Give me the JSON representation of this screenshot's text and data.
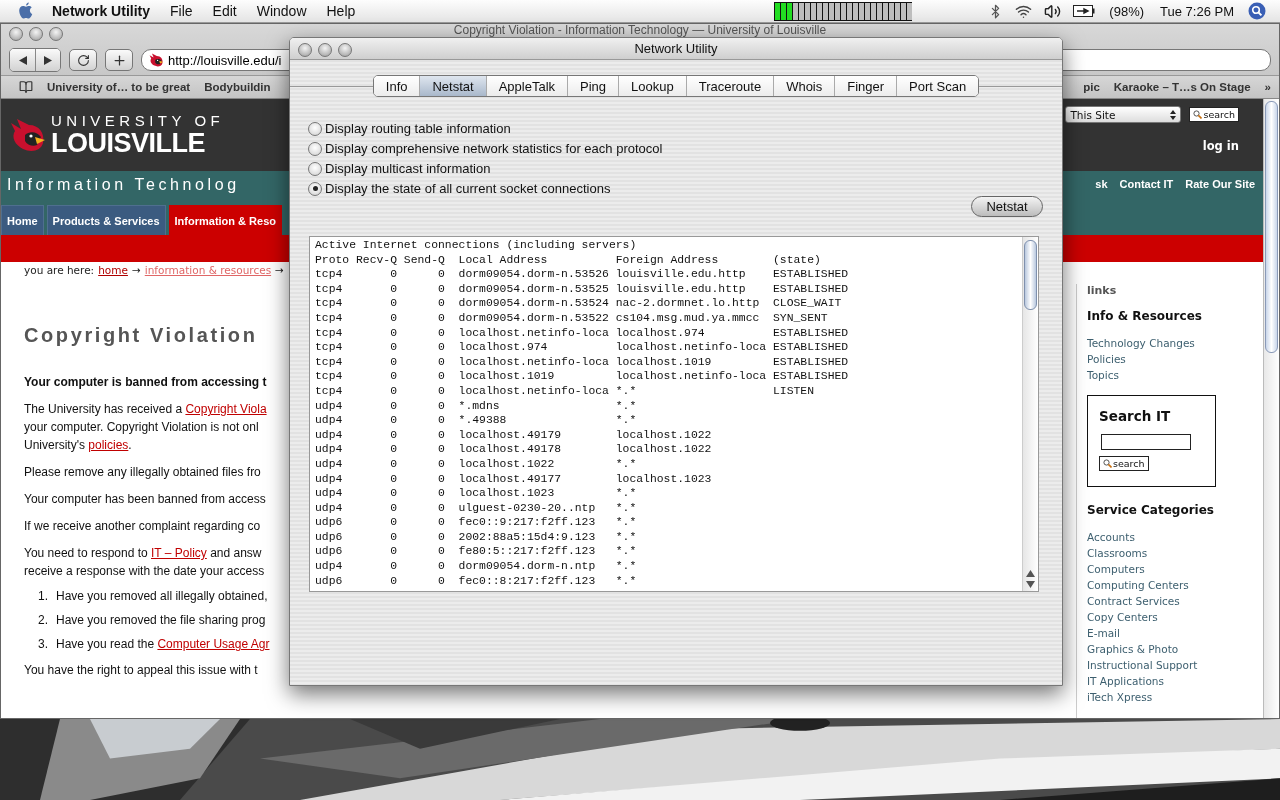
{
  "menu_bar": {
    "app_name": "Network Utility",
    "menus": [
      "File",
      "Edit",
      "Window",
      "Help"
    ],
    "battery": "(98%)",
    "clock": "Tue 7:26 PM"
  },
  "browser": {
    "title": "Copyright Violation - Information Technology — University of Louisville",
    "url": "http://louisville.edu/i",
    "bookmarks_left": [
      "University of… to be great",
      "Bodybuildin"
    ],
    "bookmarks_right": [
      "pic",
      "Karaoke – T…s On Stage"
    ],
    "bookmarks_more": "»"
  },
  "page": {
    "logo": {
      "line_1": "UNIVERSITY OF",
      "line_2": "LOUISVILLE"
    },
    "site_search": {
      "scope": "This Site",
      "button": "search"
    },
    "login": "log in",
    "banner": "Information Technolog",
    "top_links": [
      "sk",
      "Contact IT",
      "Rate Our Site"
    ],
    "nav_tabs": [
      {
        "label": "Home",
        "selected": false
      },
      {
        "label": "Products & Services",
        "selected": false
      },
      {
        "label": "Information & Reso",
        "selected": true
      }
    ],
    "breadcrumb": [
      {
        "text": "you are here:",
        "kind": "plain"
      },
      {
        "text": "home",
        "kind": "link"
      },
      {
        "text": "→",
        "kind": "plain"
      },
      {
        "text": "information & resources",
        "kind": "visited"
      },
      {
        "text": "→",
        "kind": "plain"
      }
    ],
    "heading": "Copyright Violation",
    "blocks": [
      {
        "kind": "bold",
        "lines": [
          [
            {
              "text": "Your computer is banned from accessing t"
            }
          ]
        ]
      },
      {
        "kind": "text",
        "lines": [
          [
            {
              "text": "The University has received a "
            },
            {
              "text": "Copyright Viola",
              "link": true
            }
          ],
          [
            {
              "text": "your computer. Copyright Violation is not onl"
            }
          ],
          [
            {
              "text": "University's "
            },
            {
              "text": "policies",
              "link": true
            },
            {
              "text": "."
            }
          ]
        ]
      },
      {
        "kind": "text",
        "lines": [
          [
            {
              "text": "Please remove any illegally obtained files fro"
            }
          ]
        ]
      },
      {
        "kind": "text",
        "lines": [
          [
            {
              "text": "Your computer has been banned from access"
            }
          ]
        ]
      },
      {
        "kind": "text",
        "lines": [
          [
            {
              "text": "If we receive another complaint regarding co"
            }
          ]
        ]
      },
      {
        "kind": "text",
        "lines": [
          [
            {
              "text": "You need to respond to "
            },
            {
              "text": "IT – Policy",
              "link": true
            },
            {
              "text": " and answ"
            }
          ],
          [
            {
              "text": "receive a response with the date your access"
            }
          ]
        ]
      },
      {
        "kind": "numbered",
        "number": "1.",
        "lines": [
          [
            {
              "text": "Have you removed all illegally obtained,"
            }
          ]
        ]
      },
      {
        "kind": "numbered",
        "number": "2.",
        "lines": [
          [
            {
              "text": "Have you removed the file sharing prog"
            }
          ]
        ]
      },
      {
        "kind": "numbered",
        "number": "3.",
        "lines": [
          [
            {
              "text": "Have you read the "
            },
            {
              "text": "Computer Usage Agr",
              "link": true
            }
          ]
        ]
      },
      {
        "kind": "text",
        "lines": [
          [
            {
              "text": "You have the right to appeal this issue with t"
            }
          ]
        ]
      }
    ],
    "sidebar": {
      "label": "links",
      "section_title": "Info & Resources",
      "section_links": [
        "Technology Changes",
        "Policies",
        "Topics"
      ],
      "search_title": "Search IT",
      "search_button": "search",
      "categories_title": "Service Categories",
      "categories": [
        "Accounts",
        "Classrooms",
        "Computers",
        "Computing Centers",
        "Contract Services",
        "Copy Centers",
        "E-mail",
        "Graphics & Photo",
        "Instructional Support",
        "IT Applications",
        "iTech Xpress"
      ]
    }
  },
  "network_utility": {
    "title": "Network Utility",
    "tabs": [
      {
        "label": "Info",
        "selected": false
      },
      {
        "label": "Netstat",
        "selected": true
      },
      {
        "label": "AppleTalk",
        "selected": false
      },
      {
        "label": "Ping",
        "selected": false
      },
      {
        "label": "Lookup",
        "selected": false
      },
      {
        "label": "Traceroute",
        "selected": false
      },
      {
        "label": "Whois",
        "selected": false
      },
      {
        "label": "Finger",
        "selected": false
      },
      {
        "label": "Port Scan",
        "selected": false
      }
    ],
    "options": [
      {
        "label": "Display routing table information",
        "selected": false
      },
      {
        "label": "Display comprehensive network statistics for each protocol",
        "selected": false
      },
      {
        "label": "Display multicast information",
        "selected": false
      },
      {
        "label": "Display the state of all current socket connections",
        "selected": true
      }
    ],
    "button": "Netstat",
    "output": [
      "Active Internet connections (including servers)",
      "Proto Recv-Q Send-Q  Local Address          Foreign Address        (state)",
      "tcp4       0      0  dorm09054.dorm-n.53526 louisville.edu.http    ESTABLISHED",
      "tcp4       0      0  dorm09054.dorm-n.53525 louisville.edu.http    ESTABLISHED",
      "tcp4       0      0  dorm09054.dorm-n.53524 nac-2.dormnet.lo.http  CLOSE_WAIT",
      "tcp4       0      0  dorm09054.dorm-n.53522 cs104.msg.mud.ya.mmcc  SYN_SENT",
      "tcp4       0      0  localhost.netinfo-loca localhost.974          ESTABLISHED",
      "tcp4       0      0  localhost.974          localhost.netinfo-loca ESTABLISHED",
      "tcp4       0      0  localhost.netinfo-loca localhost.1019         ESTABLISHED",
      "tcp4       0      0  localhost.1019         localhost.netinfo-loca ESTABLISHED",
      "tcp4       0      0  localhost.netinfo-loca *.*                    LISTEN",
      "udp4       0      0  *.mdns                 *.*",
      "udp4       0      0  *.49388                *.*",
      "udp4       0      0  localhost.49179        localhost.1022",
      "udp4       0      0  localhost.49178        localhost.1022",
      "udp4       0      0  localhost.1022         *.*",
      "udp4       0      0  localhost.49177        localhost.1023",
      "udp4       0      0  localhost.1023         *.*",
      "udp4       0      0  ulguest-0230-20..ntp   *.*",
      "udp6       0      0  fec0::9:217:f2ff.123   *.*",
      "udp6       0      0  2002:88a5:15d4:9.123   *.*",
      "udp6       0      0  fe80:5::217:f2ff.123   *.*",
      "udp4       0      0  dorm09054.dorm-n.ntp   *.*",
      "udp6       0      0  fec0::8:217:f2ff.123   *.*"
    ]
  }
}
